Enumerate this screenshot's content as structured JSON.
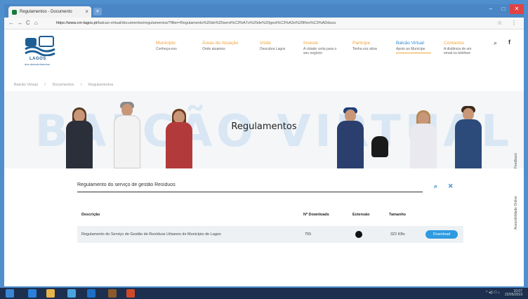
{
  "browser": {
    "tab_title": "Regulamentos - Documento",
    "tab_close": "×",
    "new_tab": "+",
    "url_domain": "https://www.cm-lagos.pt",
    "url_path": "/balcao-virtual/documentos/regulamentos/?filter=Regulamento%20do%20servi%C3%A7o%20de%20gest%C3%A3o%20Res%C3%ADduos",
    "win_min": "–",
    "win_max": "□",
    "win_close": "✕",
    "back": "←",
    "forward": "→",
    "reload": "C",
    "home": "⌂",
    "star": "☆",
    "menu": "⋮"
  },
  "logo": {
    "text": "LAGOS",
    "subtext": "dos descobrimentos"
  },
  "header": {
    "menu": [
      {
        "title": "Município",
        "sub": "Conheça-nos"
      },
      {
        "title": "Áreas de Atuação",
        "sub": "Onde atuamos"
      },
      {
        "title": "Visite",
        "sub": "Descubra Lagos"
      },
      {
        "title": "Investe",
        "sub": "A cidade certa para o seu negócio"
      },
      {
        "title": "Participe",
        "sub": "Tenha voz ativa"
      },
      {
        "title": "Balcão Virtual",
        "sub": "Apoio ao Munícipe"
      },
      {
        "title": "Contactos",
        "sub": "A distância de um email ou telefone"
      }
    ],
    "search_icon": "⌕",
    "facebook_icon": "f"
  },
  "breadcrumb": [
    "Balcão Virtual",
    "/",
    "Documentos",
    "/",
    "Regulamentos"
  ],
  "banner": {
    "background_text": "BALCÃO VIRTUAL",
    "title": "Regulamentos"
  },
  "sidebar_tabs": {
    "feedback": "Feedback",
    "accessibility": "Acessibilidade Online"
  },
  "search": {
    "value": "Regulamento do serviço de gestão Resíduos",
    "search_icon": "⌕",
    "clear_icon": "✕"
  },
  "table": {
    "headers": {
      "description": "Descrição",
      "downloads": "Nº Downloads",
      "extension": "Extensão",
      "size": "Tamanho"
    },
    "rows": [
      {
        "description": "Regulamento do Serviço de Gestão de Resíduos Urbanos do Município de Lagos",
        "downloads": "755",
        "size": "322 KBs",
        "button": "Download"
      }
    ]
  },
  "taskbar": {
    "time": "10:07",
    "date": "22/05/2019",
    "tray": "^ ◂)) ☐ ⌂"
  },
  "colors": {
    "accent_orange": "#f0a33a",
    "accent_blue": "#2e8bd0",
    "button_blue": "#2e9be0"
  }
}
